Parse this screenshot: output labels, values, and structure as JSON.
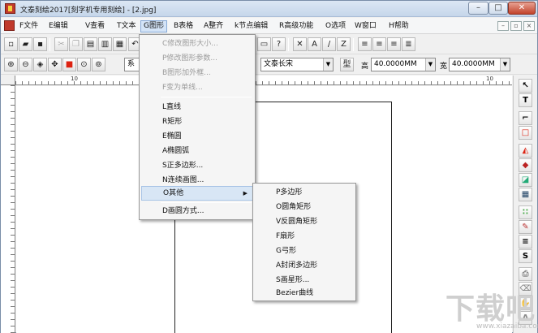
{
  "window": {
    "title": "文泰刻绘2017[刻字机专用刻绘] - [2.jpg]",
    "controls": {
      "minimize": "–",
      "maximize": "□",
      "close": "✕"
    }
  },
  "menubar": {
    "items": [
      {
        "label": "F文件"
      },
      {
        "label": "E编辑"
      },
      {
        "label": "V查看"
      },
      {
        "label": "T文本"
      },
      {
        "label": "G图形"
      },
      {
        "label": "B表格"
      },
      {
        "label": "A整齐"
      },
      {
        "label": "k节点编辑"
      },
      {
        "label": "R高级功能"
      },
      {
        "label": "O选项"
      },
      {
        "label": "W窗口"
      },
      {
        "label": "H帮助"
      }
    ],
    "mdi": {
      "minimize": "–",
      "restore": "▫",
      "close": "×"
    }
  },
  "toolbar1": {
    "font_combo": "文泰长宋",
    "height_label": "高",
    "height_value": "40.0000MM",
    "width_label": "宽",
    "width_value": "40.0000MM"
  },
  "toolbar2": {
    "partial_text": "系"
  },
  "ruler": {
    "marks": [
      "10",
      "10"
    ]
  },
  "graphics_menu": {
    "items": [
      {
        "label": "C修改图形大小...",
        "disabled": true
      },
      {
        "label": "P修改图形参数...",
        "disabled": true
      },
      {
        "label": "B图形加外框...",
        "disabled": true
      },
      {
        "label": "F变为单线...",
        "disabled": true
      },
      {
        "label": "L直线",
        "disabled": false
      },
      {
        "label": "R矩形",
        "disabled": false
      },
      {
        "label": "E椭圆",
        "disabled": false
      },
      {
        "label": "A椭圆弧",
        "disabled": false
      },
      {
        "label": "S正多边形...",
        "disabled": false
      },
      {
        "label": "N连续画图...",
        "disabled": false
      },
      {
        "label": "O其他",
        "disabled": false,
        "submenu": true
      },
      {
        "label": "D画圆方式...",
        "disabled": false
      }
    ]
  },
  "other_submenu": {
    "items": [
      {
        "label": "P多边形"
      },
      {
        "label": "O圆角矩形"
      },
      {
        "label": "V反圆角矩形"
      },
      {
        "label": "F扇形"
      },
      {
        "label": "G弓形"
      },
      {
        "label": "A封闭多边形"
      },
      {
        "label": "S画星形..."
      },
      {
        "label": "Bezier曲线"
      }
    ]
  },
  "watermark": {
    "text": "下载吧",
    "url": "www.xiazaiba.com"
  }
}
